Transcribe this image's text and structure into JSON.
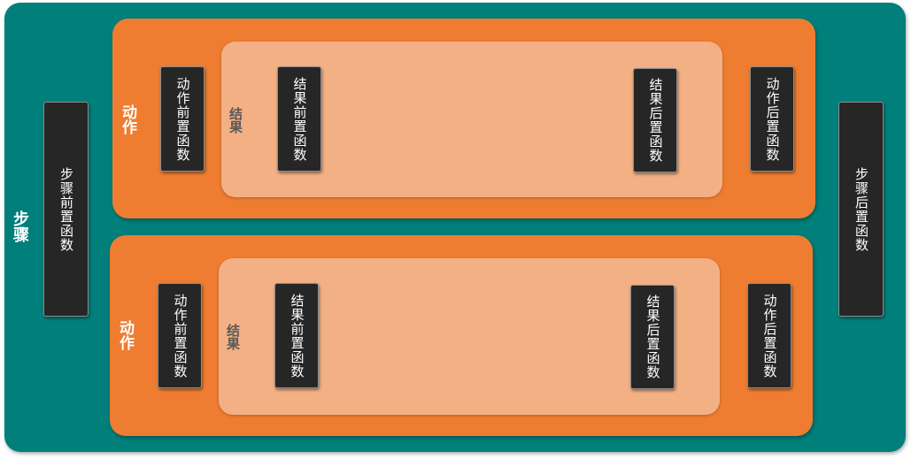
{
  "diagram": {
    "step": {
      "label": "步骤",
      "pre_function": "步骤前置函数",
      "post_function": "步骤后置函数"
    },
    "actions": [
      {
        "label": "动作",
        "pre_function": "动作前置函数",
        "post_function": "动作后置函数",
        "result": {
          "label": "结果",
          "pre_function": "结果前置函数",
          "post_function": "结果后置函数"
        }
      },
      {
        "label": "动作",
        "pre_function": "动作前置函数",
        "post_function": "动作后置函数",
        "result": {
          "label": "结果",
          "pre_function": "结果前置函数",
          "post_function": "结果后置函数"
        }
      }
    ],
    "colors": {
      "step_fill": "#017f7a",
      "action_fill": "#ee7d31",
      "result_fill": "#f3b084",
      "function_fill": "#262626"
    }
  }
}
